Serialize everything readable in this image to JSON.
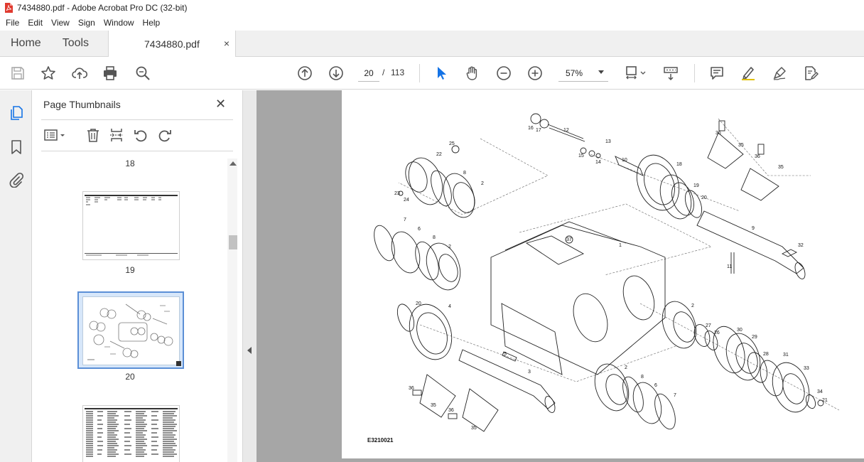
{
  "window": {
    "title": "7434880.pdf - Adobe Acrobat Pro DC (32-bit)"
  },
  "menu": [
    "File",
    "Edit",
    "View",
    "Sign",
    "Window",
    "Help"
  ],
  "tabs": {
    "home": "Home",
    "tools": "Tools",
    "document": "7434880.pdf",
    "close": "×"
  },
  "toolbar": {
    "page_current": "20",
    "page_sep": "/",
    "page_total": "113",
    "zoom": "57%"
  },
  "panel": {
    "title": "Page Thumbnails",
    "close": "✕",
    "thumbnails": [
      {
        "label": "18"
      },
      {
        "label": "19"
      },
      {
        "label": "20"
      },
      {
        "label": ""
      }
    ]
  },
  "document": {
    "drawing_code": "E3210021",
    "callouts": [
      "1",
      "2",
      "2",
      "2",
      "2",
      "3",
      "4",
      "5",
      "6",
      "6",
      "7",
      "7",
      "8",
      "8",
      "8",
      "9",
      "10",
      "11",
      "12",
      "13",
      "14",
      "15",
      "16",
      "17",
      "18",
      "19",
      "20",
      "20",
      "21",
      "22",
      "23",
      "24",
      "25",
      "26",
      "27",
      "28",
      "29",
      "30",
      "31",
      "32",
      "33",
      "34",
      "35",
      "35",
      "35",
      "35",
      "36",
      "36",
      "36",
      "36",
      "37"
    ]
  },
  "colors": {
    "selection": "#5b8fd6",
    "cursor_icon": "#1473e6"
  }
}
